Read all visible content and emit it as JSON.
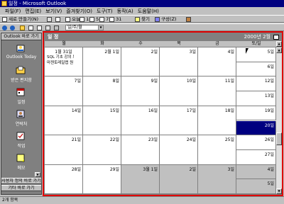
{
  "window": {
    "title": "일정 - Microsoft Outlook"
  },
  "menu": [
    "파일(F)",
    "편집(E)",
    "보기(V)",
    "즐겨찾기(O)",
    "도구(T)",
    "동작(A)",
    "도움말(H)"
  ],
  "toolbar1": {
    "new_label": "새로 만들기(N)",
    "day_label": "오늘",
    "work_week_label": "1",
    "week_label": "5",
    "seven_label": "7",
    "month_label": "31",
    "find_label": "찾기",
    "organize_label": "구성(Z)"
  },
  "toolbar2": {
    "view_value": "일/주/월"
  },
  "outlook_bar": {
    "header": "Outlook 바로 가기",
    "items": [
      {
        "label": "Outlook Today"
      },
      {
        "label": "받은 편지함"
      },
      {
        "label": "일정"
      },
      {
        "label": "연락처"
      },
      {
        "label": "작업"
      },
      {
        "label": "메모"
      }
    ],
    "groups": [
      {
        "label": "사용자 정의 바로 가기"
      },
      {
        "label": "기타 바로 가기"
      }
    ]
  },
  "calendar": {
    "folder_title": "일 정",
    "date_label": "2000년 2월",
    "weekdays": [
      "월",
      "화",
      "수",
      "목",
      "금",
      "토/일"
    ],
    "weeks": [
      {
        "days": [
          "1월 31일",
          "2월 1일",
          "2일",
          "3일",
          "4일"
        ],
        "sat": "5일",
        "sun": "6일"
      },
      {
        "days": [
          "7일",
          "8일",
          "9일",
          "10일",
          "11일"
        ],
        "sat": "12일",
        "sun": "13일"
      },
      {
        "days": [
          "14일",
          "15일",
          "16일",
          "17일",
          "18일"
        ],
        "sat": "19일",
        "sun": "20일"
      },
      {
        "days": [
          "21일",
          "22일",
          "23일",
          "24일",
          "25일"
        ],
        "sat": "26일",
        "sun": "27일"
      },
      {
        "days": [
          "28일",
          "29일",
          "3월 1일",
          "2일",
          "3일"
        ],
        "sat": "4일",
        "sun": "5일"
      }
    ],
    "events": [
      "SQL 기초 강의 트",
      "마젠토레일랩 원"
    ]
  },
  "status": {
    "text": "2개 항목"
  }
}
